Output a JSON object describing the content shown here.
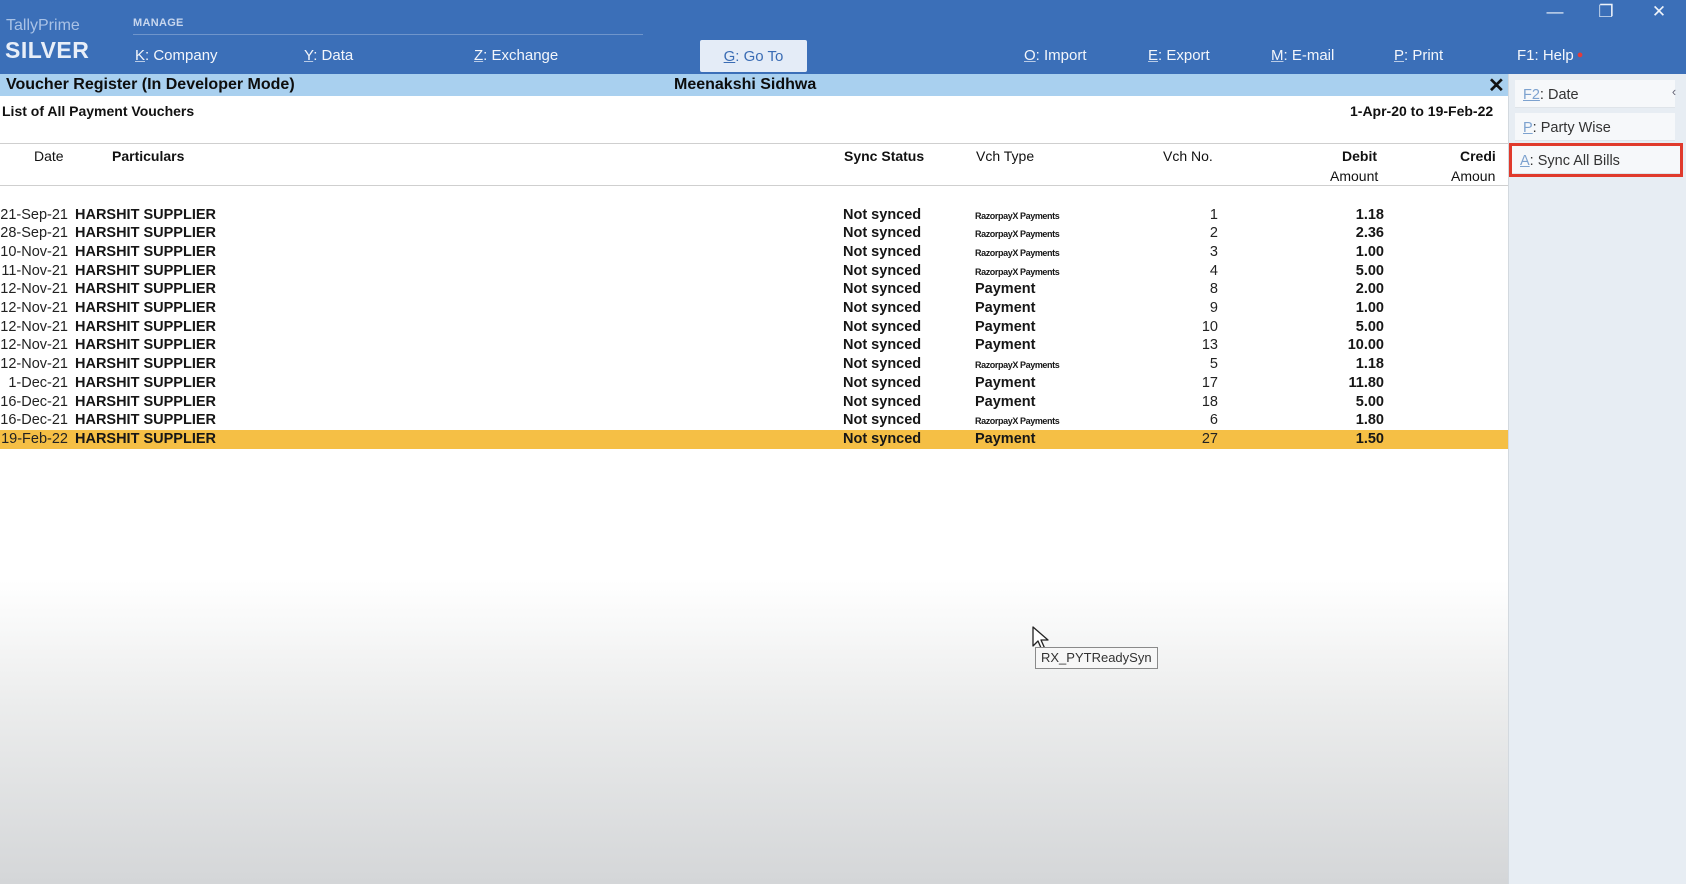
{
  "brand": {
    "product": "TallyPrime",
    "edition": "SILVER"
  },
  "menu": {
    "section": "MANAGE",
    "items": [
      {
        "key": "K",
        "label": ": Company"
      },
      {
        "key": "Y",
        "label": ": Data"
      },
      {
        "key": "Z",
        "label": ": Exchange"
      },
      {
        "key": "G",
        "label": ": Go To"
      },
      {
        "key": "O",
        "label": ": Import"
      },
      {
        "key": "E",
        "label": ": Export"
      },
      {
        "key": "M",
        "label": ": E-mail"
      },
      {
        "key": "P",
        "label": ": Print"
      },
      {
        "key": "F1",
        "label": ": Help"
      }
    ]
  },
  "window_controls": {
    "minimize": "—",
    "restore": "❐",
    "close": "✕"
  },
  "title": {
    "left": "Voucher Register (In Developer Mode)",
    "center": "Meenakshi Sidhwa",
    "close": "✕"
  },
  "report": {
    "subtitle": "List of All Payment Vouchers",
    "period": "1-Apr-20 to 19-Feb-22",
    "columns": {
      "date": "Date",
      "particulars": "Particulars",
      "sync": "Sync Status",
      "type": "Vch Type",
      "no": "Vch No.",
      "debit": "Debit",
      "debit_sub": "Amount",
      "credit": "Credi",
      "credit_sub": "Amoun"
    },
    "rows": [
      {
        "date": "21-Sep-21",
        "particulars": "HARSHIT SUPPLIER",
        "sync": "Not synced",
        "type": "RazorpayX Payments",
        "no": "1",
        "debit": "1.18"
      },
      {
        "date": "28-Sep-21",
        "particulars": "HARSHIT SUPPLIER",
        "sync": "Not synced",
        "type": "RazorpayX Payments",
        "no": "2",
        "debit": "2.36"
      },
      {
        "date": "10-Nov-21",
        "particulars": "HARSHIT SUPPLIER",
        "sync": "Not synced",
        "type": "RazorpayX Payments",
        "no": "3",
        "debit": "1.00"
      },
      {
        "date": "11-Nov-21",
        "particulars": "HARSHIT SUPPLIER",
        "sync": "Not synced",
        "type": "RazorpayX Payments",
        "no": "4",
        "debit": "5.00"
      },
      {
        "date": "12-Nov-21",
        "particulars": "HARSHIT SUPPLIER",
        "sync": "Not synced",
        "type": "Payment",
        "no": "8",
        "debit": "2.00"
      },
      {
        "date": "12-Nov-21",
        "particulars": "HARSHIT SUPPLIER",
        "sync": "Not synced",
        "type": "Payment",
        "no": "9",
        "debit": "1.00"
      },
      {
        "date": "12-Nov-21",
        "particulars": "HARSHIT SUPPLIER",
        "sync": "Not synced",
        "type": "Payment",
        "no": "10",
        "debit": "5.00"
      },
      {
        "date": "12-Nov-21",
        "particulars": "HARSHIT SUPPLIER",
        "sync": "Not synced",
        "type": "Payment",
        "no": "13",
        "debit": "10.00"
      },
      {
        "date": "12-Nov-21",
        "particulars": "HARSHIT SUPPLIER",
        "sync": "Not synced",
        "type": "RazorpayX Payments",
        "no": "5",
        "debit": "1.18"
      },
      {
        "date": "1-Dec-21",
        "particulars": "HARSHIT SUPPLIER",
        "sync": "Not synced",
        "type": "Payment",
        "no": "17",
        "debit": "11.80"
      },
      {
        "date": "16-Dec-21",
        "particulars": "HARSHIT SUPPLIER",
        "sync": "Not synced",
        "type": "Payment",
        "no": "18",
        "debit": "5.00"
      },
      {
        "date": "16-Dec-21",
        "particulars": "HARSHIT SUPPLIER",
        "sync": "Not synced",
        "type": "RazorpayX Payments",
        "no": "6",
        "debit": "1.80"
      },
      {
        "date": "19-Feb-22",
        "particulars": "HARSHIT SUPPLIER",
        "sync": "Not synced",
        "type": "Payment",
        "no": "27",
        "debit": "1.50"
      }
    ],
    "selected_row": 12
  },
  "right_panel": {
    "buttons": [
      {
        "key": "F2",
        "label": ": Date"
      },
      {
        "key": "P",
        "label": ": Party Wise"
      },
      {
        "key": "A",
        "label": ": Sync All Bills"
      }
    ],
    "collapse": "‹"
  },
  "tooltip": "RX_PYTReadySyn",
  "colors": {
    "topbar": "#3b6fb8",
    "titlebar": "#a9d0ef",
    "selected_row": "#f5bf45",
    "highlight_box": "#e03a2c"
  }
}
